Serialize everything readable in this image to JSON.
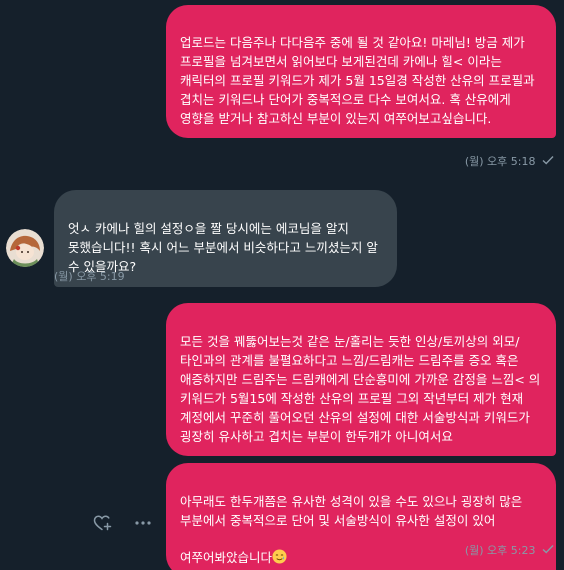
{
  "conversation": {
    "messages": [
      {
        "direction": "outgoing",
        "text": "업로드는 다음주나 다다음주 중에 될 것 같아요! 마레님! 방금 제가 프로필을 넘겨보면서 읽어보다 보게된건데 카에나 힐< 이라는 캐릭터의 프로필 키워드가 제가 5월 15일경 작성한 산유의 프로필과 겹치는 키워드나 단어가 중복적으로 다수 보여서요. 혹 산유에게 영향을 받거나 참고하신 부분이 있는지 여쭈어보고싶습니다.",
        "timestamp": "(월) 오후 5:18",
        "status_icon": "checkmark-icon"
      },
      {
        "direction": "incoming",
        "text": "엇ㅅ 카에나 힐의 설정ㅇ을 짤 당시에는 에코님을 알지 못했습니다!! 혹시 어느 부분에서 비슷하다고 느끼셨는지 알 수 있을까요?",
        "timestamp": "(월) 오후 5:19"
      },
      {
        "direction": "outgoing",
        "text": "모든 것을 꿰뚫어보는것 같은 눈/홀리는 듯한 인상/토끼상의 외모/타인과의 관계를 불펼요하다고 느낌/드림캐는 드림주를 증오 혹은 애증하지만 드림주는 드림캐에게 단순흥미에 가까운 감정을 느낌< 의 키워드가 5월15에 작성한 산유의 프로필 그외 작년부터 제가 현재 계정에서 꾸준히 풀어오던 산유의 설정에 대한 서술방식과 키워드가 굉장히 유사하고 겹치는 부분이 한두개가 아니여서요"
      },
      {
        "direction": "outgoing",
        "text": "아무래도 한두개쯤은 유사한 성격이 있을 수도 있으나 굉장히 많은 부분에서 중복적으로 단어 및 서술방식이 유사한 설정이 있어 여쭈어봐았습니다",
        "emoji": "smiling-face-with-tear-emoji",
        "timestamp": "(월) 오후 5:23",
        "status_icon": "checkmark-icon"
      }
    ]
  },
  "colors": {
    "background": "#15202b",
    "outgoing_bubble": "#e0245e",
    "incoming_bubble": "#38444d",
    "meta_text": "#8899a6"
  },
  "actions": {
    "react_icon": "heart-plus-icon",
    "more_icon": "more-dots-icon"
  }
}
